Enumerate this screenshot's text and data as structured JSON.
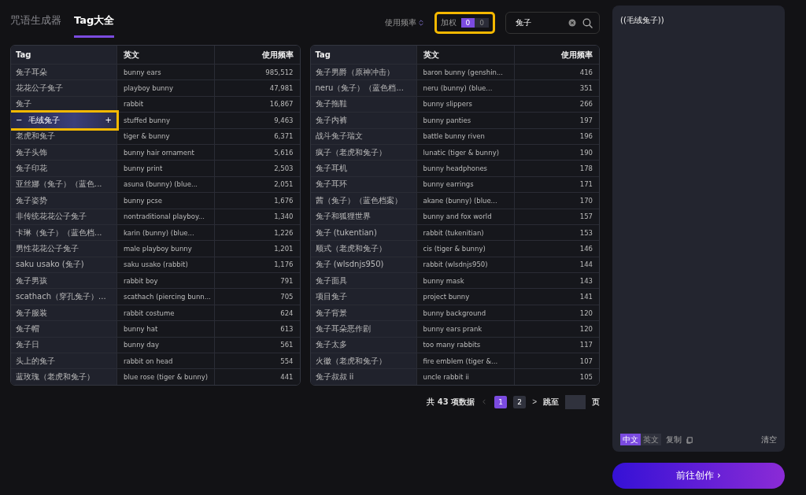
{
  "tabs": [
    {
      "label": "咒语生成器",
      "selected": false
    },
    {
      "label": "Tag大全",
      "selected": true
    }
  ],
  "sort": {
    "label": "使用频率"
  },
  "weight": {
    "label": "加权",
    "highlighted": true,
    "options": [
      {
        "label": "0",
        "selected": true
      },
      {
        "label": "0",
        "selected": false
      }
    ]
  },
  "search": {
    "value": "兔子"
  },
  "tables": [
    {
      "columns": [
        "Tag",
        "英文",
        "使用频率"
      ],
      "rows": [
        {
          "tag": "兔子耳朵",
          "en": "bunny ears",
          "freq": "985,512",
          "hovered": false
        },
        {
          "tag": "花花公子兔子",
          "en": "playboy bunny",
          "freq": "47,981",
          "hovered": false
        },
        {
          "tag": "兔子",
          "en": "rabbit",
          "freq": "16,867",
          "hovered": false
        },
        {
          "tag": "毛绒兔子",
          "en": "stuffed bunny",
          "freq": "9,463",
          "hovered": true,
          "minus": "−",
          "plus": "+"
        },
        {
          "tag": "老虎和兔子",
          "en": "tiger & bunny",
          "freq": "6,371",
          "hovered": false
        },
        {
          "tag": "兔子头饰",
          "en": "bunny hair ornament",
          "freq": "5,616",
          "hovered": false
        },
        {
          "tag": "兔子印花",
          "en": "bunny print",
          "freq": "2,503",
          "hovered": false
        },
        {
          "tag": "亚丝娜（兔子）（蓝色...",
          "en": "asuna (bunny) (blue...",
          "freq": "2,051",
          "hovered": false
        },
        {
          "tag": "兔子姿势",
          "en": "bunny pcse",
          "freq": "1,676",
          "hovered": false
        },
        {
          "tag": "非传统花花公子兔子",
          "en": "nontraditional playboy...",
          "freq": "1,340",
          "hovered": false
        },
        {
          "tag": "卡琳（兔子）（蓝色档...",
          "en": "karin (bunny) (blue...",
          "freq": "1,226",
          "hovered": false
        },
        {
          "tag": "男性花花公子兔子",
          "en": "male playboy bunny",
          "freq": "1,201",
          "hovered": false
        },
        {
          "tag": "saku usako (兔子)",
          "en": "saku usako (rabbit)",
          "freq": "1,176",
          "hovered": false
        },
        {
          "tag": "兔子男孩",
          "en": "rabbit boy",
          "freq": "791",
          "hovered": false
        },
        {
          "tag": "scathach（穿孔兔子）...",
          "en": "scathach (piercing bunn...",
          "freq": "705",
          "hovered": false
        },
        {
          "tag": "兔子服装",
          "en": "rabbit costume",
          "freq": "624",
          "hovered": false
        },
        {
          "tag": "兔子帽",
          "en": "bunny hat",
          "freq": "613",
          "hovered": false
        },
        {
          "tag": "兔子日",
          "en": "bunny day",
          "freq": "561",
          "hovered": false
        },
        {
          "tag": "头上的兔子",
          "en": "rabbit on head",
          "freq": "554",
          "hovered": false
        },
        {
          "tag": "蓝玫瑰（老虎和兔子）",
          "en": "blue rose (tiger & bunny)",
          "freq": "441",
          "hovered": false
        }
      ]
    },
    {
      "columns": [
        "Tag",
        "英文",
        "使用频率"
      ],
      "rows": [
        {
          "tag": "兔子男爵（原神冲击）",
          "en": "baron bunny (genshin...",
          "freq": "416",
          "hovered": false
        },
        {
          "tag": "neru（兔子）（蓝色档...",
          "en": "neru (bunny) (blue...",
          "freq": "351",
          "hovered": false
        },
        {
          "tag": "兔子拖鞋",
          "en": "bunny slippers",
          "freq": "266",
          "hovered": false
        },
        {
          "tag": "兔子内裤",
          "en": "bunny panties",
          "freq": "197",
          "hovered": false
        },
        {
          "tag": "战斗兔子瑞文",
          "en": "battle bunny riven",
          "freq": "196",
          "hovered": false
        },
        {
          "tag": "疯子（老虎和兔子）",
          "en": "lunatic (tiger & bunny)",
          "freq": "190",
          "hovered": false
        },
        {
          "tag": "兔子耳机",
          "en": "bunny headphones",
          "freq": "178",
          "hovered": false
        },
        {
          "tag": "兔子耳环",
          "en": "bunny earrings",
          "freq": "171",
          "hovered": false
        },
        {
          "tag": "茜（兔子）（蓝色档案）",
          "en": "akane (bunny) (blue...",
          "freq": "170",
          "hovered": false
        },
        {
          "tag": "兔子和狐狸世界",
          "en": "bunny and fox world",
          "freq": "157",
          "hovered": false
        },
        {
          "tag": "兔子 (tukentian)",
          "en": "rabbit (tukenitian)",
          "freq": "153",
          "hovered": false
        },
        {
          "tag": "顺式（老虎和兔子）",
          "en": "cis (tiger & bunny)",
          "freq": "146",
          "hovered": false
        },
        {
          "tag": "兔子 (wlsdnjs950)",
          "en": "rabbit (wlsdnjs950)",
          "freq": "144",
          "hovered": false
        },
        {
          "tag": "兔子面具",
          "en": "bunny mask",
          "freq": "143",
          "hovered": false
        },
        {
          "tag": "项目兔子",
          "en": "project bunny",
          "freq": "141",
          "hovered": false
        },
        {
          "tag": "兔子背景",
          "en": "bunny background",
          "freq": "120",
          "hovered": false
        },
        {
          "tag": "兔子耳朵恶作剧",
          "en": "bunny ears prank",
          "freq": "120",
          "hovered": false
        },
        {
          "tag": "兔子太多",
          "en": "too many rabbits",
          "freq": "117",
          "hovered": false
        },
        {
          "tag": "火徽（老虎和兔子）",
          "en": "fire emblem (tiger &...",
          "freq": "107",
          "hovered": false
        },
        {
          "tag": "兔子叔叔 ii",
          "en": "uncle rabbit ii",
          "freq": "105",
          "hovered": false
        }
      ]
    }
  ],
  "pagination": {
    "total": "共 43 项数据",
    "pages": [
      {
        "label": "1",
        "selected": true
      },
      {
        "label": "2",
        "selected": false
      }
    ],
    "next": ">",
    "jump_label": "跳至",
    "page_unit": "页"
  },
  "prompt_panel": {
    "text": "((毛绒兔子))",
    "languages": [
      {
        "label": "中文",
        "selected": true
      },
      {
        "label": "英文",
        "selected": false
      }
    ],
    "copy": "复制",
    "clear": "清空"
  },
  "create_button": {
    "label": "前往创作",
    "arrow": "›"
  }
}
